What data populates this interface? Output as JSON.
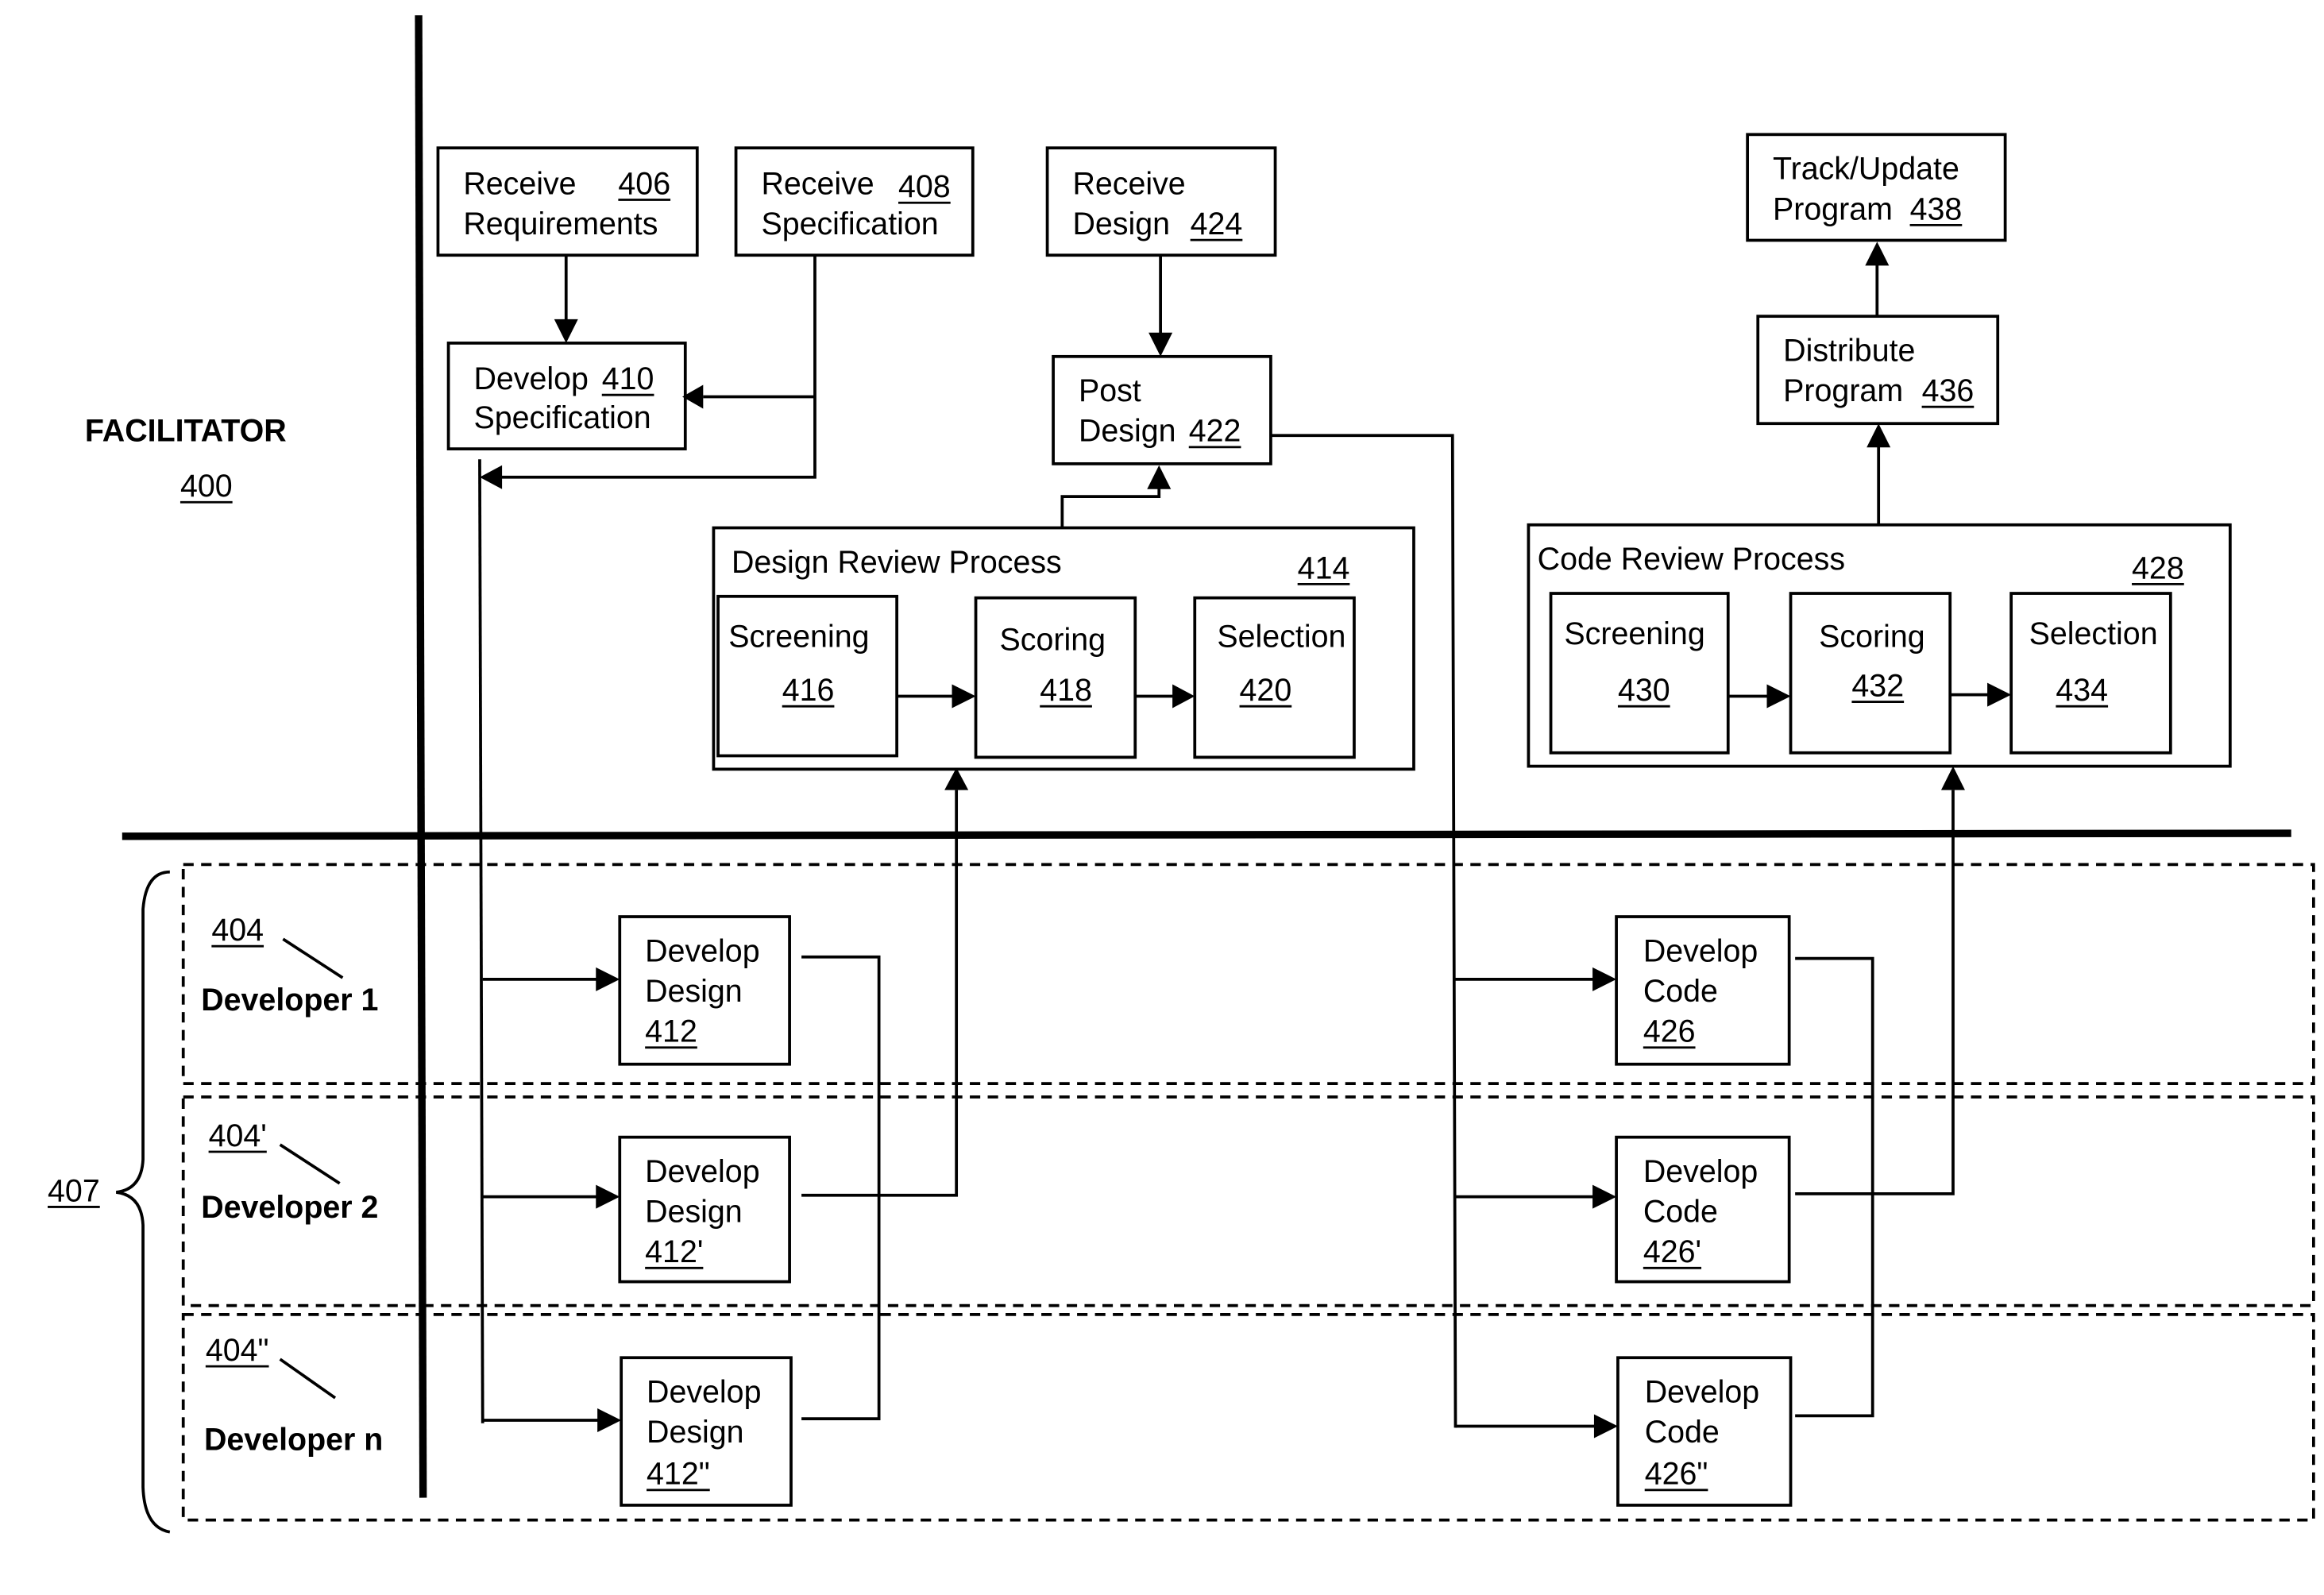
{
  "facilitator": {
    "label": "FACILITATOR",
    "ref": "400"
  },
  "group": {
    "ref": "407"
  },
  "boxes": {
    "receive_requirements": {
      "line1": "Receive",
      "ref": "406",
      "line2": "Requirements"
    },
    "receive_specification": {
      "line1": "Receive",
      "ref": "408",
      "line2": "Specification"
    },
    "develop_specification": {
      "line1": "Develop",
      "ref": "410",
      "line2": "Specification"
    },
    "receive_design": {
      "line1": "Receive",
      "line2": "Design",
      "ref": "424"
    },
    "post_design": {
      "line1": "Post",
      "line2": "Design",
      "ref": "422"
    },
    "track_update": {
      "line1": "Track/Update",
      "line2": "Program",
      "ref": "438"
    },
    "distribute": {
      "line1": "Distribute",
      "line2": "Program",
      "ref": "436"
    }
  },
  "design_review": {
    "title": "Design Review Process",
    "ref": "414",
    "steps": [
      {
        "label": "Screening",
        "ref": "416"
      },
      {
        "label": "Scoring",
        "ref": "418"
      },
      {
        "label": "Selection",
        "ref": "420"
      }
    ]
  },
  "code_review": {
    "title": "Code Review Process",
    "ref": "428",
    "steps": [
      {
        "label": "Screening",
        "ref": "430"
      },
      {
        "label": "Scoring",
        "ref": "432"
      },
      {
        "label": "Selection",
        "ref": "434"
      }
    ]
  },
  "developers": [
    {
      "name": "Developer 1",
      "ref": "404",
      "design": {
        "l1": "Develop",
        "l2": "Design",
        "ref": "412"
      },
      "code": {
        "l1": "Develop",
        "l2": "Code",
        "ref": "426"
      }
    },
    {
      "name": "Developer 2",
      "ref": "404'",
      "design": {
        "l1": "Develop",
        "l2": "Design",
        "ref": "412'"
      },
      "code": {
        "l1": "Develop",
        "l2": "Code",
        "ref": "426'"
      }
    },
    {
      "name": "Developer n",
      "ref": "404\"",
      "design": {
        "l1": "Develop",
        "l2": "Design",
        "ref": "412\""
      },
      "code": {
        "l1": "Develop",
        "l2": "Code",
        "ref": "426\""
      }
    }
  ]
}
